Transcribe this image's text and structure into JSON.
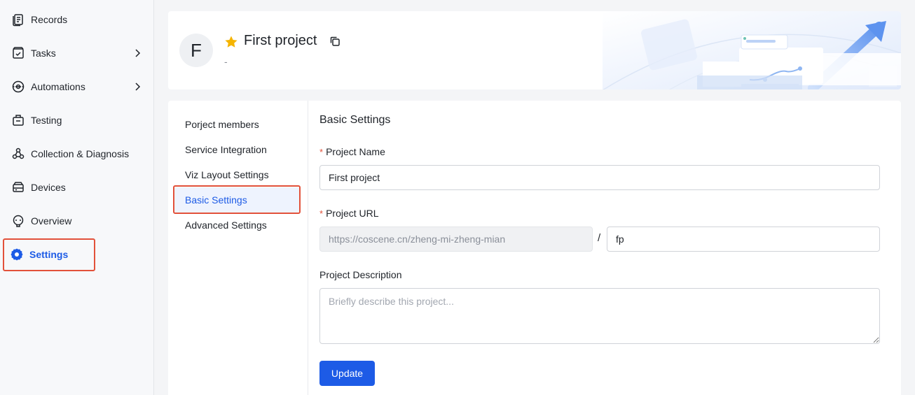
{
  "sidebar": {
    "items": [
      {
        "label": "Records",
        "icon": "records-icon"
      },
      {
        "label": "Tasks",
        "icon": "tasks-icon",
        "has_submenu": true
      },
      {
        "label": "Automations",
        "icon": "automations-icon",
        "has_submenu": true
      },
      {
        "label": "Testing",
        "icon": "testing-icon"
      },
      {
        "label": "Collection & Diagnosis",
        "icon": "diagnosis-icon"
      },
      {
        "label": "Devices",
        "icon": "devices-icon"
      },
      {
        "label": "Overview",
        "icon": "overview-icon"
      },
      {
        "label": "Settings",
        "icon": "gear-icon",
        "active": true
      }
    ]
  },
  "header": {
    "avatar_letter": "F",
    "title": "First project",
    "subtitle": "-",
    "starred": true
  },
  "submenu": {
    "items": [
      {
        "label": "Porject members"
      },
      {
        "label": "Service Integration"
      },
      {
        "label": "Viz Layout Settings"
      },
      {
        "label": "Basic Settings",
        "active": true
      },
      {
        "label": "Advanced Settings"
      }
    ]
  },
  "form": {
    "section_title": "Basic Settings",
    "required_mark": "*",
    "project_name_label": "Project Name",
    "project_name_value": "First project",
    "project_url_label": "Project URL",
    "project_url_prefix": "https://coscene.cn/zheng-mi-zheng-mian",
    "url_separator": "/",
    "project_url_slug": "fp",
    "description_label": "Project Description",
    "description_placeholder": "Briefly describe this project...",
    "update_label": "Update"
  },
  "colors": {
    "accent": "#1d5be6",
    "highlight_box": "#e2513a",
    "star": "#f5b400"
  }
}
